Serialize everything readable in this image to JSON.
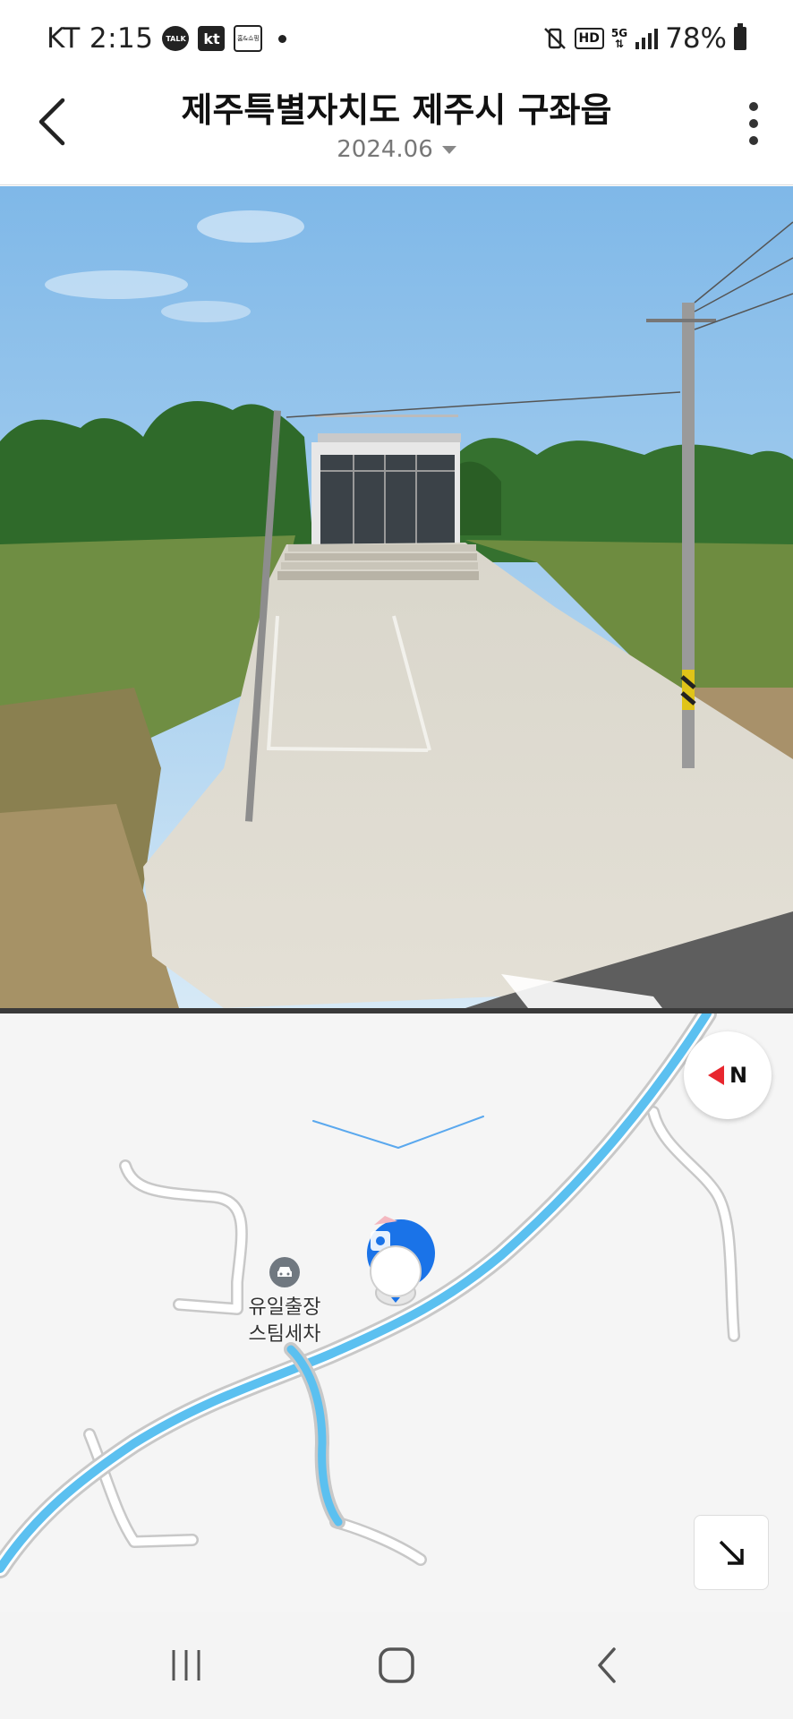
{
  "status_bar": {
    "carrier": "KT",
    "time": "2:15",
    "talk_badge": "TALK",
    "kt_badge": "kt",
    "home_badge": "홈&쇼핑",
    "hd_badge": "HD",
    "network": "5G",
    "battery": "78%"
  },
  "header": {
    "title": "제주특별자치도 제주시 구좌읍",
    "date": "2024.06"
  },
  "map": {
    "compass_label": "N",
    "poi": {
      "label_line1": "유일출장",
      "label_line2": "스팀세차",
      "icon": "car-wash-icon"
    },
    "road_color": "#5bc0f0",
    "marker_color": "#1a73e8"
  },
  "icons": {
    "back": "chevron-left-icon",
    "more": "more-vertical-icon",
    "expand": "arrow-down-right-icon",
    "recents": "recents-icon",
    "home": "home-icon",
    "nav_back": "nav-back-icon"
  }
}
